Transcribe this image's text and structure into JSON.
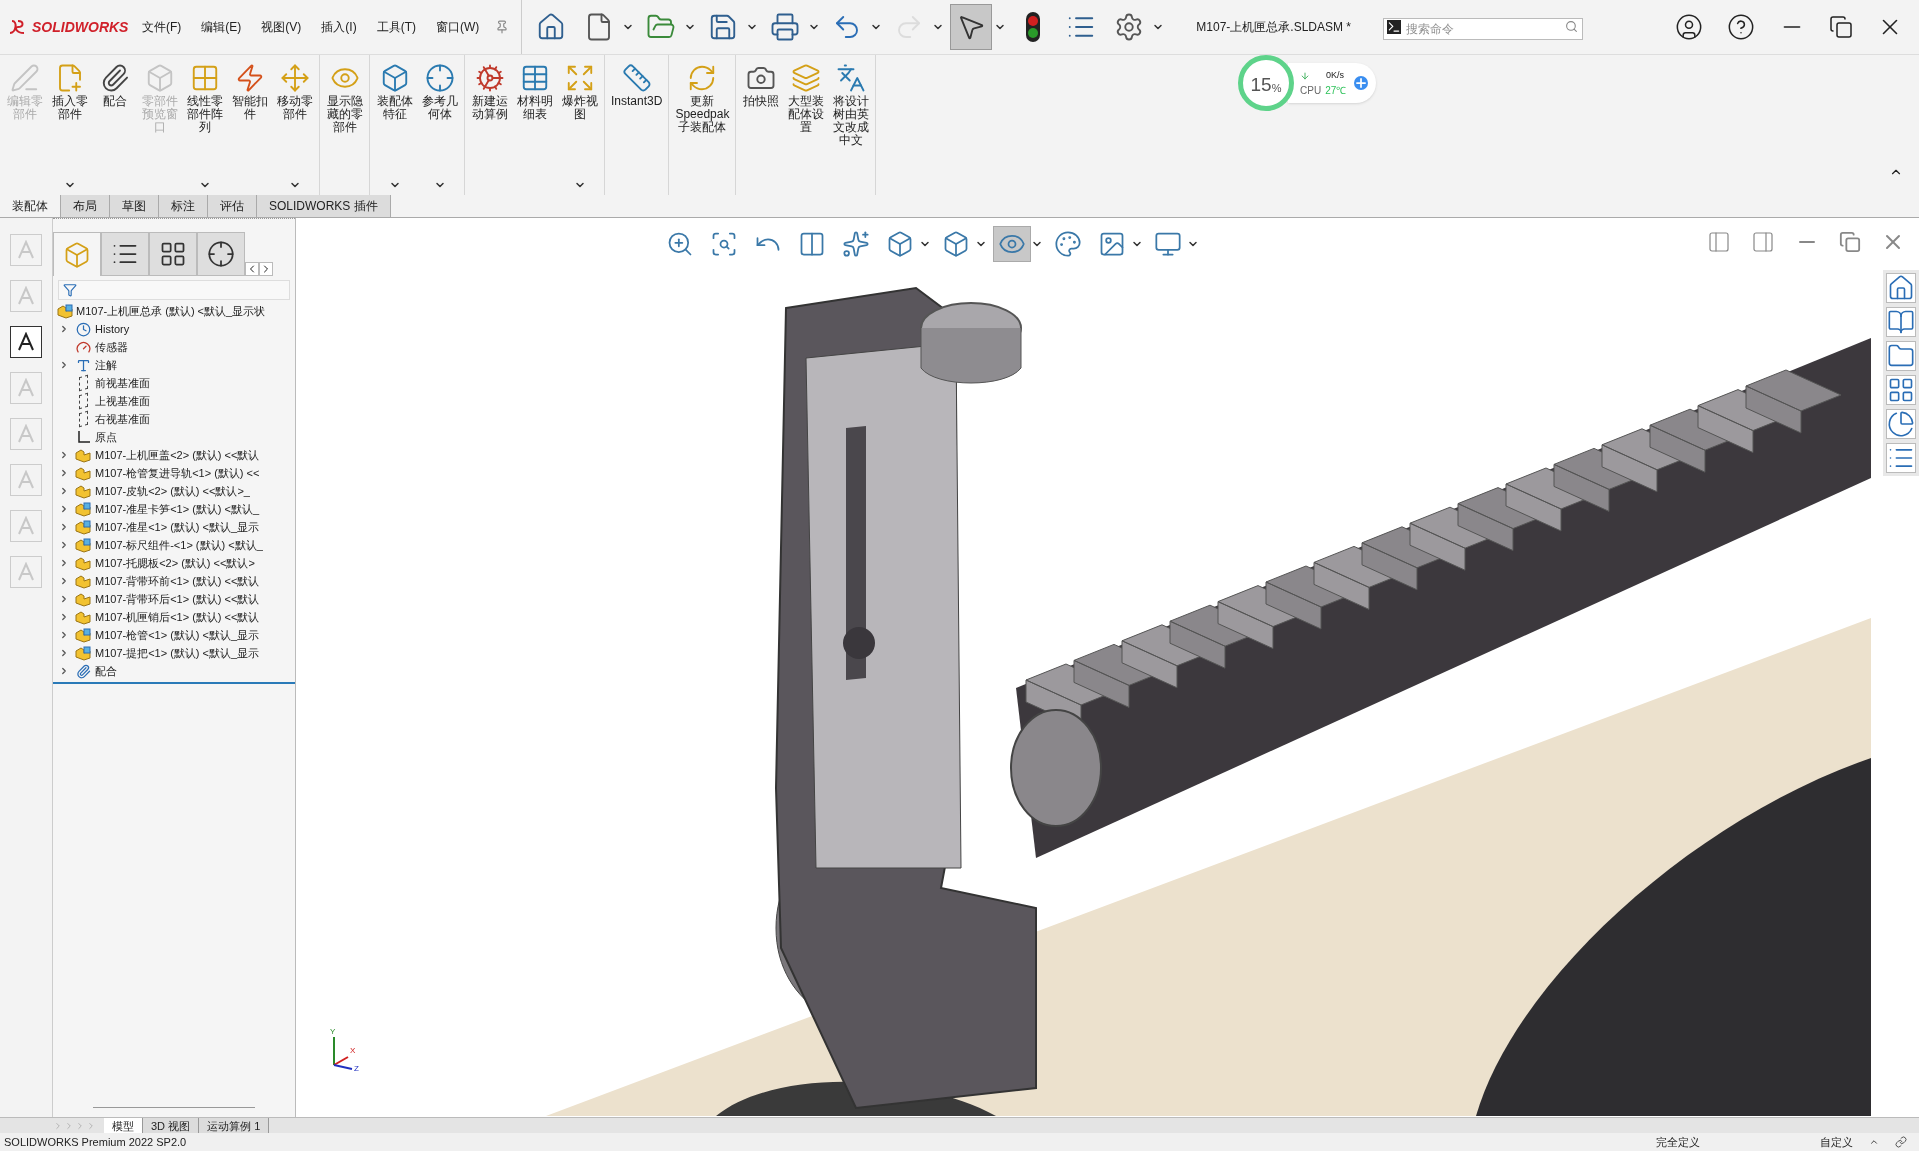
{
  "app": {
    "logo": "SOLIDWORKS"
  },
  "menus": [
    "文件(F)",
    "编辑(E)",
    "视图(V)",
    "插入(I)",
    "工具(T)",
    "窗口(W)"
  ],
  "quick_access": [
    {
      "pressed": false,
      "disabled": false,
      "dropdown": false
    },
    {
      "pressed": false,
      "disabled": false,
      "dropdown": true
    },
    {
      "pressed": false,
      "disabled": false,
      "dropdown": true
    },
    {
      "pressed": false,
      "disabled": false,
      "dropdown": true
    },
    {
      "pressed": false,
      "disabled": false,
      "dropdown": true
    },
    {
      "pressed": false,
      "disabled": false,
      "dropdown": true
    },
    {
      "pressed": false,
      "disabled": true,
      "dropdown": true
    },
    {
      "pressed": true,
      "disabled": false,
      "dropdown": true
    },
    {
      "pressed": false,
      "disabled": false,
      "dropdown": false
    },
    {
      "pressed": false,
      "disabled": false,
      "dropdown": false
    },
    {
      "pressed": false,
      "disabled": false,
      "dropdown": true
    }
  ],
  "document_title": "M107-上机匣总承.SLDASM *",
  "search": {
    "placeholder": "搜索命令"
  },
  "monitor": {
    "percent": "15",
    "unit": "%",
    "speed": "0K/s",
    "cpu_label": "CPU",
    "temperature": "27℃"
  },
  "ribbon_groups": [
    [
      {
        "label": "编辑零部件",
        "disabled": true,
        "dropdown": false
      },
      {
        "label": "插入零部件",
        "disabled": false,
        "dropdown": true
      },
      {
        "label": "配合",
        "disabled": false,
        "dropdown": false
      },
      {
        "label": "零部件预览窗口",
        "disabled": true,
        "dropdown": false
      },
      {
        "label": "线性零部件阵列",
        "disabled": false,
        "dropdown": true
      },
      {
        "label": "智能扣件",
        "disabled": false,
        "dropdown": false
      },
      {
        "label": "移动零部件",
        "disabled": false,
        "dropdown": true
      }
    ],
    [
      {
        "label": "显示隐藏的零部件",
        "disabled": false,
        "dropdown": false
      }
    ],
    [
      {
        "label": "装配体特征",
        "disabled": false,
        "dropdown": true
      },
      {
        "label": "参考几何体",
        "disabled": false,
        "dropdown": true
      }
    ],
    [
      {
        "label": "新建运动算例",
        "disabled": false,
        "dropdown": false
      },
      {
        "label": "材料明细表",
        "disabled": false,
        "dropdown": false
      },
      {
        "label": "爆炸视图",
        "disabled": false,
        "dropdown": true
      }
    ],
    [
      {
        "label": "Instant3D",
        "disabled": false,
        "dropdown": false
      }
    ],
    [
      {
        "label": "更新Speedpak子装配体",
        "disabled": false,
        "dropdown": false
      }
    ],
    [
      {
        "label": "拍快照",
        "disabled": false,
        "dropdown": false
      },
      {
        "label": "大型装配体设置",
        "disabled": false,
        "dropdown": false
      },
      {
        "label": "将设计树由英文改成中文",
        "disabled": false,
        "dropdown": false
      }
    ]
  ],
  "ribbon_tabs": [
    {
      "label": "装配体",
      "selected": true
    },
    {
      "label": "布局",
      "selected": false
    },
    {
      "label": "草图",
      "selected": false
    },
    {
      "label": "标注",
      "selected": false
    },
    {
      "label": "评估",
      "selected": false
    },
    {
      "label": "SOLIDWORKS 插件",
      "selected": false
    }
  ],
  "view_toolbar": [
    {
      "pressed": false,
      "dropdown": false
    },
    {
      "pressed": false,
      "dropdown": false
    },
    {
      "pressed": false,
      "dropdown": false
    },
    {
      "pressed": false,
      "dropdown": false
    },
    {
      "pressed": false,
      "dropdown": false
    },
    {
      "pressed": false,
      "dropdown": true
    },
    {
      "pressed": false,
      "dropdown": true
    },
    {
      "pressed": true,
      "dropdown": true
    },
    {
      "pressed": false,
      "dropdown": false
    },
    {
      "pressed": false,
      "dropdown": true
    },
    {
      "pressed": false,
      "dropdown": true
    }
  ],
  "panel_tabs": [
    {
      "selected": true
    },
    {
      "selected": false
    },
    {
      "selected": false
    },
    {
      "selected": false
    }
  ],
  "tree": {
    "root": "M107-上机匣总承 (默认) <默认_显示状",
    "items": [
      {
        "kind": "history",
        "label": "History",
        "expandable": true
      },
      {
        "kind": "sensor",
        "label": "传感器",
        "expandable": false
      },
      {
        "kind": "annotation",
        "label": "注解",
        "expandable": true
      },
      {
        "kind": "plane",
        "label": "前视基准面",
        "expandable": false
      },
      {
        "kind": "plane",
        "label": "上视基准面",
        "expandable": false
      },
      {
        "kind": "plane",
        "label": "右视基准面",
        "expandable": false
      },
      {
        "kind": "origin",
        "label": "原点",
        "expandable": false
      },
      {
        "kind": "part",
        "label": "M107-上机匣盖<2> (默认) <<默认",
        "expandable": true
      },
      {
        "kind": "part",
        "label": "M107-枪管复进导轨<1> (默认) <<",
        "expandable": true
      },
      {
        "kind": "part",
        "label": "M107-皮轨<2> (默认) <<默认>_",
        "expandable": true
      },
      {
        "kind": "subassembly",
        "label": "M107-准星卡笋<1> (默认) <默认_",
        "expandable": true
      },
      {
        "kind": "subassembly",
        "label": "M107-准星<1> (默认) <默认_显示",
        "expandable": true
      },
      {
        "kind": "subassembly",
        "label": "M107-标尺组件-<1> (默认) <默认_",
        "expandable": true
      },
      {
        "kind": "part",
        "label": "M107-托腮板<2> (默认) <<默认>",
        "expandable": true
      },
      {
        "kind": "part",
        "label": "M107-背带环前<1> (默认) <<默认",
        "expandable": true
      },
      {
        "kind": "part",
        "label": "M107-背带环后<1> (默认) <<默认",
        "expandable": true
      },
      {
        "kind": "part",
        "label": "M107-机匣销后<1> (默认) <<默认",
        "expandable": true
      },
      {
        "kind": "subassembly",
        "label": "M107-枪管<1> (默认) <默认_显示",
        "expandable": true
      },
      {
        "kind": "subassembly",
        "label": "M107-提把<1> (默认) <默认_显示",
        "expandable": true
      },
      {
        "kind": "mates",
        "label": "配合",
        "expandable": true
      }
    ]
  },
  "triad": {
    "x": "X",
    "y": "Y",
    "z": "Z"
  },
  "bottom_tabs": [
    {
      "label": "模型",
      "selected": true
    },
    {
      "label": "3D 视图",
      "selected": false
    },
    {
      "label": "运动算例 1",
      "selected": false
    }
  ],
  "status_bar": {
    "version": "SOLIDWORKS Premium 2022 SP2.0",
    "state": "完全定义",
    "units": "自定义"
  }
}
